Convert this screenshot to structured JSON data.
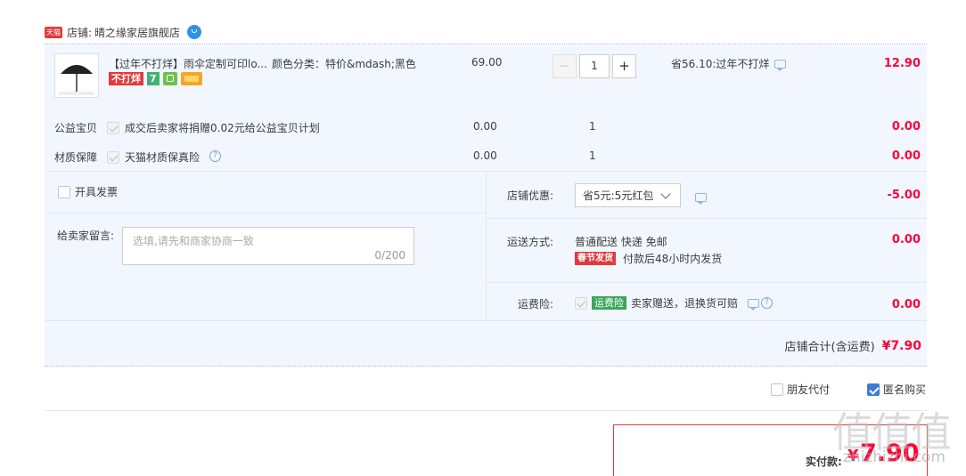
{
  "shop": {
    "tmall_badge": "天猫",
    "label": "店铺:",
    "name": "晴之缘家居旗舰店"
  },
  "item": {
    "title": "【过年不打烊】雨伞定制可印lo...",
    "sku": "颜色分类：特价&mdash;黑色",
    "tag_closed": "不打烊",
    "tag_seven": "7",
    "unit_price": "69.00",
    "quantity": "1",
    "qty_minus": "−",
    "qty_plus": "+",
    "discount": "省56.10:过年不打烊",
    "subtotal": "12.90"
  },
  "extras": [
    {
      "label": "公益宝贝",
      "desc": "成交后卖家将捐赠0.02元给公益宝贝计划",
      "price": "0.00",
      "qty": "1",
      "total": "0.00"
    },
    {
      "label": "材质保障",
      "desc": "天猫材质保真险",
      "price": "0.00",
      "qty": "1",
      "total": "0.00"
    }
  ],
  "invoice": {
    "label": "开具发票"
  },
  "message": {
    "label": "给卖家留言:",
    "placeholder": "选填,请先和商家协商一致",
    "counter": "0/200"
  },
  "coupon": {
    "label": "店铺优惠:",
    "selected": "省5元:5元红包",
    "amount": "-5.00"
  },
  "shipping": {
    "label": "运送方式:",
    "method": "普通配送 快递 免邮",
    "tag": "春节发货",
    "note": "付款后48小时内发货",
    "amount": "0.00"
  },
  "insurance": {
    "label": "运费险:",
    "tag": "运费险",
    "note": "卖家赠送，退换货可赔",
    "amount": "0.00"
  },
  "shop_total": {
    "label": "店铺合计(含运费)",
    "value": "¥7.90"
  },
  "options": {
    "friend_pay": "朋友代付",
    "anonymous": "匿名购买"
  },
  "pay": {
    "label": "实付款:",
    "currency": "¥",
    "amount": "7.90"
  },
  "watermark": {
    "logo": "值值值",
    "site": "zhizhizhi.com"
  },
  "colors": {
    "accent_red": "#ff0036",
    "panel_bg": "#f2f7ff",
    "divider": "#b8cde8",
    "checkbox_blue": "#3d7bd9"
  }
}
